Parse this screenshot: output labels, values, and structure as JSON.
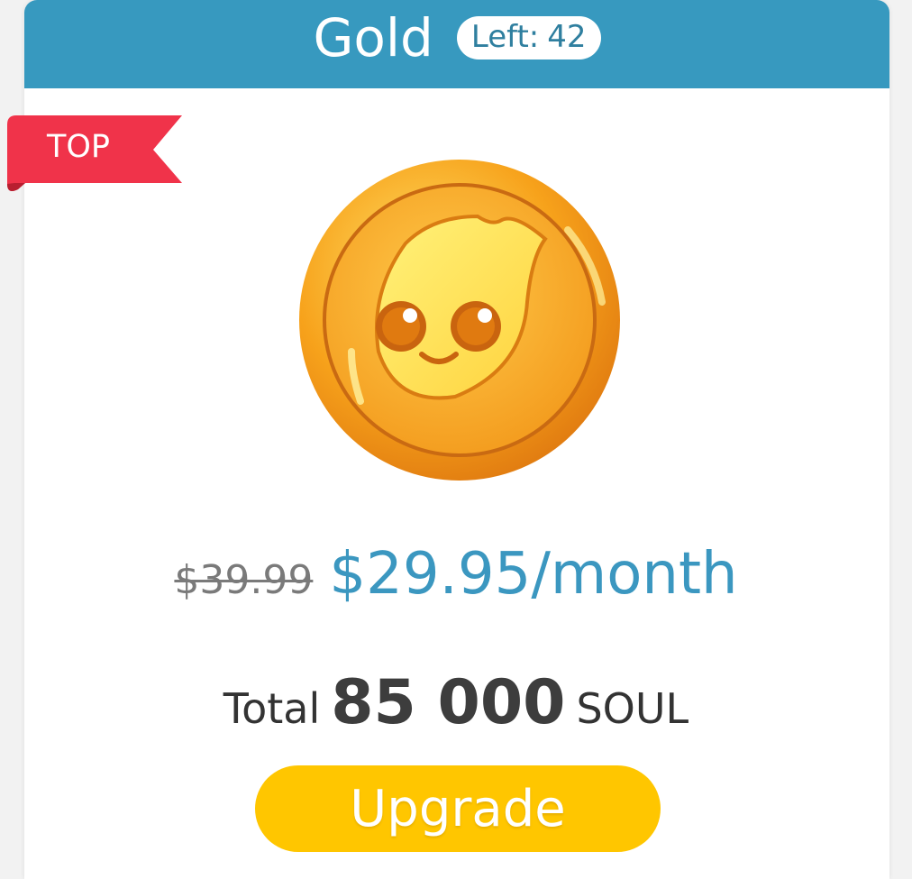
{
  "plan": {
    "name": "Gold",
    "left_label": "Left:",
    "left_count": "42",
    "ribbon_label": "TOP",
    "coin_icon": "gold-soul-coin-icon",
    "old_price": "$39.99",
    "new_price": "$29.95/month",
    "total_label": "Total",
    "total_amount": "85 000",
    "total_unit": "SOUL",
    "upgrade_label": "Upgrade"
  },
  "colors": {
    "header": "#3799bf",
    "price": "#3b97c0",
    "ribbon": "#f0334a",
    "button": "#ffc600"
  }
}
